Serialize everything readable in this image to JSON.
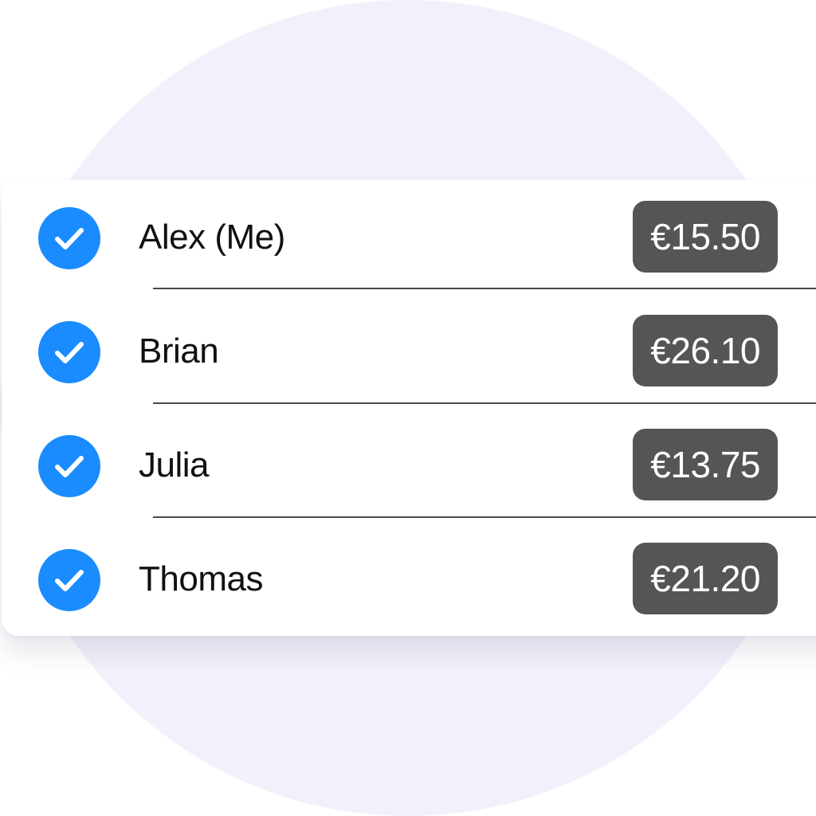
{
  "colors": {
    "background_circle": "#f1f1fb",
    "check_blue": "#1a8cff",
    "amount_badge": "#555555"
  },
  "participants": [
    {
      "name": "Alex (Me)",
      "amount": "€15.50",
      "checked": true,
      "icon": "checkmark-circle-icon"
    },
    {
      "name": "Brian",
      "amount": "€26.10",
      "checked": true,
      "icon": "checkmark-circle-icon"
    },
    {
      "name": "Julia",
      "amount": "€13.75",
      "checked": true,
      "icon": "checkmark-circle-icon"
    },
    {
      "name": "Thomas",
      "amount": "€21.20",
      "checked": true,
      "icon": "checkmark-circle-icon"
    }
  ]
}
